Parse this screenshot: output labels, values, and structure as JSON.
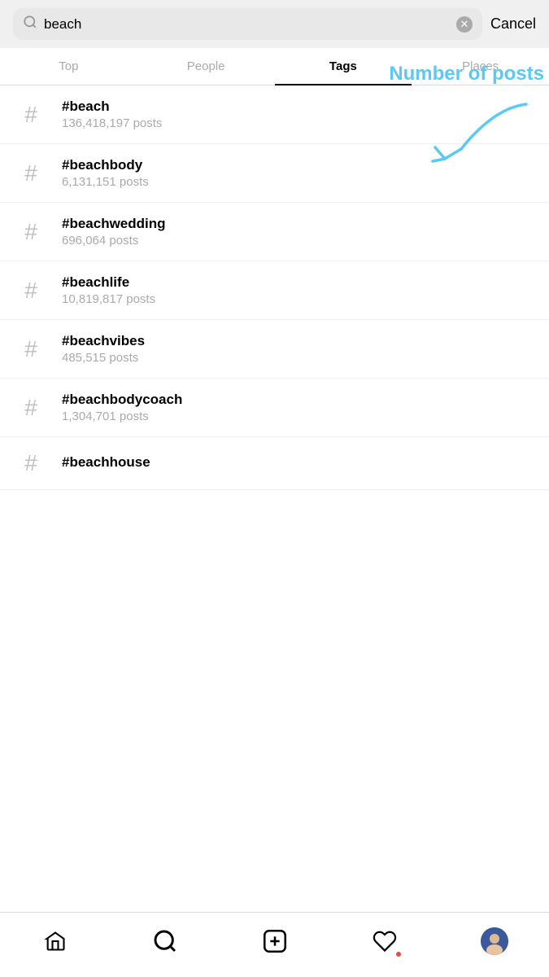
{
  "search": {
    "value": "beach",
    "placeholder": "Search",
    "clear_label": "×",
    "cancel_label": "Cancel"
  },
  "tabs": [
    {
      "id": "top",
      "label": "Top",
      "active": false
    },
    {
      "id": "people",
      "label": "People",
      "active": false
    },
    {
      "id": "tags",
      "label": "Tags",
      "active": true
    },
    {
      "id": "places",
      "label": "Places",
      "active": false
    }
  ],
  "annotation": {
    "text": "Number of posts",
    "color": "#5bc8f5"
  },
  "tags": [
    {
      "name": "#beach",
      "count": "136,418,197 posts"
    },
    {
      "name": "#beachbody",
      "count": "6,131,151 posts"
    },
    {
      "name": "#beachwedding",
      "count": "696,064 posts"
    },
    {
      "name": "#beachlife",
      "count": "10,819,817 posts"
    },
    {
      "name": "#beachvibes",
      "count": "485,515 posts"
    },
    {
      "name": "#beachbodycoach",
      "count": "1,304,701 posts"
    },
    {
      "name": "#beachhouse",
      "count": ""
    }
  ],
  "bottom_nav": [
    {
      "id": "home",
      "icon": "home",
      "label": "Home"
    },
    {
      "id": "search",
      "icon": "search",
      "label": "Search"
    },
    {
      "id": "add",
      "icon": "add",
      "label": "Add"
    },
    {
      "id": "heart",
      "icon": "heart",
      "label": "Activity"
    },
    {
      "id": "profile",
      "icon": "avatar",
      "label": "Profile"
    }
  ]
}
